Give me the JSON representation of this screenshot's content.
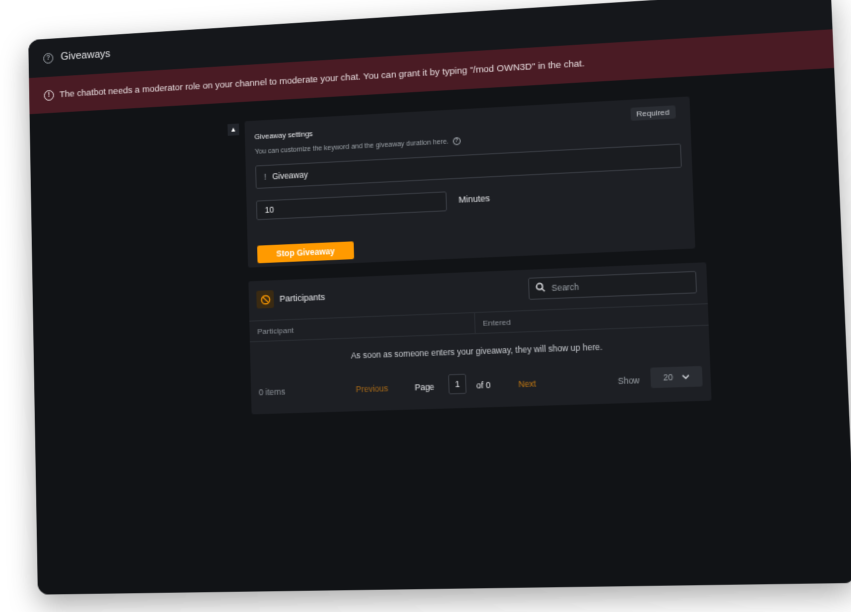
{
  "window": {
    "title": "Giveaways"
  },
  "alert": {
    "message": "The chatbot needs a moderator role on your channel to moderate your chat. You can grant it by typing \"/mod OWN3D\" in the chat."
  },
  "settings": {
    "title": "Giveaway settings",
    "hint": "You can customize the keyword and the giveaway duration here.",
    "required_badge": "Required",
    "keyword_prefix": "!",
    "keyword_value": "Giveaway",
    "duration_value": "10",
    "duration_unit": "Minutes",
    "stop_button_label": "Stop Giveaway"
  },
  "participants": {
    "title": "Participants",
    "search_placeholder": "Search",
    "columns": [
      "Participant",
      "Entered"
    ],
    "empty_message": "As soon as someone enters your giveaway, they will show up here.",
    "items_count": "0 items",
    "previous_label": "Previous",
    "page_label": "Page",
    "page_value": "1",
    "of_label": "of 0",
    "next_label": "Next",
    "show_label": "Show",
    "page_size": "20"
  },
  "colors": {
    "accent": "#ff9a00",
    "alert_bg": "#4a1b24",
    "window_bg": "#111316",
    "card_bg": "#1d1f24"
  },
  "icons": {
    "title": "help-circle-icon",
    "alert": "info-circle-icon",
    "hint": "help-circle-icon",
    "collapse": "caret-up-icon",
    "participants": "ban-icon",
    "search": "search-icon",
    "select": "chevron-down-icon"
  }
}
